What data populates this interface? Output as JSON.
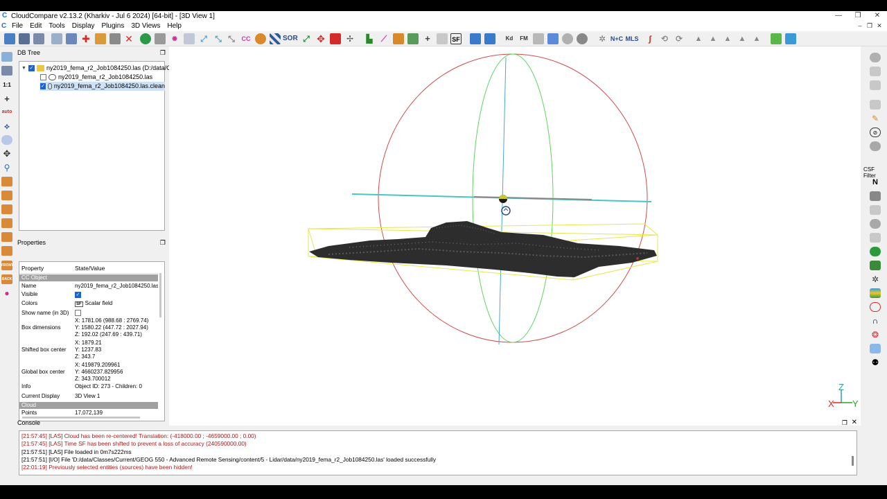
{
  "window": {
    "title": "CloudCompare v2.13.2 (Kharkiv - Jul 6 2024) [64-bit] - [3D View 1]",
    "minimize": "—",
    "maximize": "❐",
    "close": "✕"
  },
  "menu": {
    "items": [
      "File",
      "Edit",
      "Tools",
      "Display",
      "Plugins",
      "3D Views",
      "Help"
    ],
    "mdi_minimize": "–",
    "mdi_restore": "❐",
    "mdi_close": "✕"
  },
  "toolbar": {
    "sor_label": "SOR",
    "sf_label": "SF",
    "kd_label": "Kd",
    "fm_label": "FM",
    "nc_label": "N+C",
    "mls_label": "MLS",
    "cc_label": "CC"
  },
  "left_toolbar": {
    "one_to_one": "1:1",
    "auto": "auto",
    "front": "FRONT",
    "back": "BACK"
  },
  "right_toolbar": {
    "csf_label": "CSF Filter",
    "n_label": "N"
  },
  "db_tree": {
    "title": "DB Tree",
    "items": [
      {
        "label": "ny2019_fema_r2_Job1084250.las (D:/data/Cla..."
      },
      {
        "label": "ny2019_fema_r2_Job1084250.las"
      },
      {
        "label": "ny2019_fema_r2_Job1084250.las.clean"
      }
    ]
  },
  "properties": {
    "title": "Properties",
    "col_property": "Property",
    "col_value": "State/Value",
    "section_cc_object": "CC Object",
    "name_key": "Name",
    "name_val": "ny2019_fema_r2_Job1084250.las.cl",
    "visible_key": "Visible",
    "colors_key": "Colors",
    "colors_val": "Scalar field",
    "colors_icon": "SF",
    "show_name_key": "Show name (in 3D)",
    "box_dim_key": "Box dimensions",
    "box_dim_x": "X: 1781.06 (988.68 : 2769.74)",
    "box_dim_y": "Y: 1580.22 (447.72 : 2027.94)",
    "box_dim_z": "Z: 192.02 (247.69 : 439.71)",
    "shifted_key": "Shifted box center",
    "shifted_x": "X: 1879.21",
    "shifted_y": "Y: 1237.83",
    "shifted_z": "Z: 343.7",
    "global_key": "Global box center",
    "global_x": "X: 419879.209961",
    "global_y": "Y: 4660237.829956",
    "global_z": "Z: 343.700012",
    "info_key": "Info",
    "info_val": "Object ID: 273 - Children: 0",
    "current_display_key": "Current Display",
    "current_display_val": "3D View 1",
    "section_cloud": "Cloud",
    "points_key": "Points",
    "points_val": "17,072,139"
  },
  "view3d": {
    "axis_x": "X",
    "axis_y": "Y",
    "axis_z": "Z"
  },
  "console": {
    "title": "Console",
    "lines": [
      {
        "text": "[21:57:45] [LAS] Cloud has been re-centered! Translation: (-418000.00 ; -4659000.00 ; 0.00)",
        "color": "#b01818"
      },
      {
        "text": "[21:57:45] [LAS] Time SF has been shifted to prevent a loss of accuracy (240590000.00)",
        "color": "#b01818"
      },
      {
        "text": "[21:57:51] [LAS] File loaded in 0m7s222ms",
        "color": "#000000"
      },
      {
        "text": "[21:57:51] [I/O] File 'D:/data/Classes/Current/GEOG 550 - Advanced Remote Sensing/content/5 - Lidar/data/ny2019_fema_r2_Job1084250.las' loaded successfully",
        "color": "#000000"
      },
      {
        "text": "[22:01:19] Previously selected entities (sources) have been hidden!",
        "color": "#b01818"
      }
    ]
  },
  "colors": {
    "accent": "#1a64d1",
    "sphere_red": "#d44a4a",
    "sphere_green": "#5fd45f",
    "axis_blue": "#47a6d6",
    "bbox_yellow": "#e6e650"
  }
}
